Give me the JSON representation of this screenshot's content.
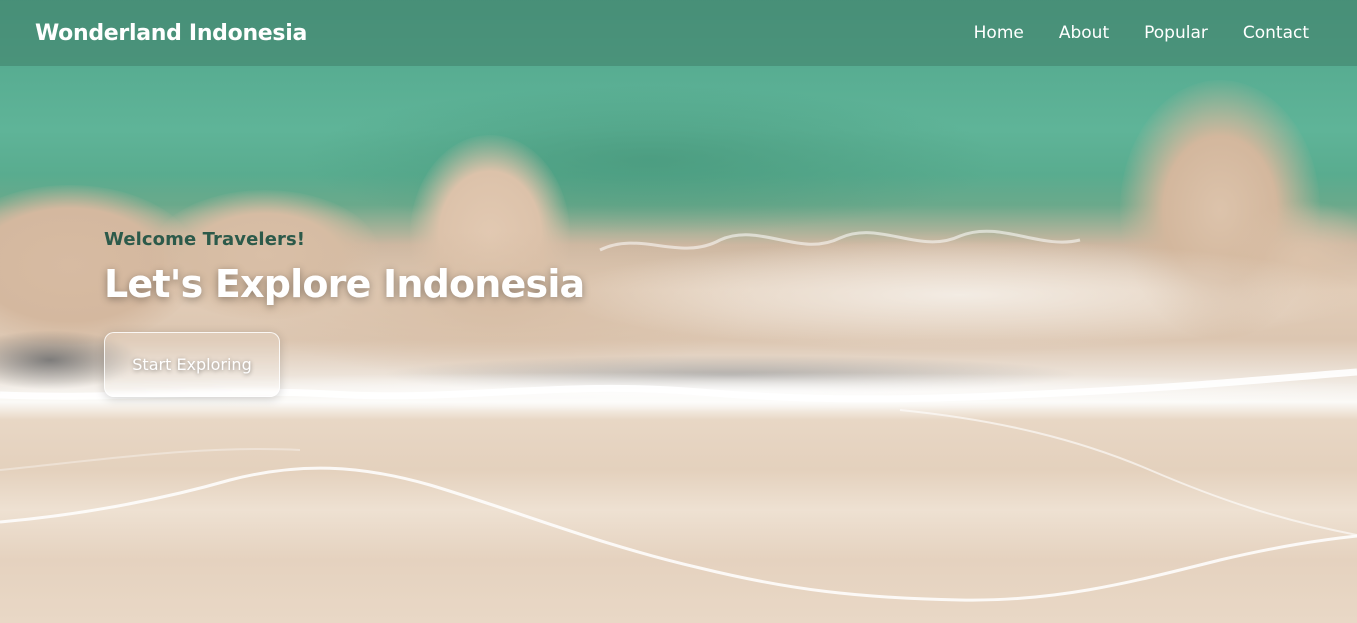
{
  "navbar": {
    "brand": "Wonderland Indonesia",
    "links": [
      {
        "label": "Home"
      },
      {
        "label": "About"
      },
      {
        "label": "Popular"
      },
      {
        "label": "Contact"
      }
    ]
  },
  "hero": {
    "greeting": "Welcome Travelers!",
    "headline": "Let's Explore Indonesia",
    "cta_label": "Start Exploring"
  },
  "colors": {
    "navbar_bg": "#499077",
    "greeting_text": "#2c5a4a",
    "text_light": "#ffffff",
    "sea": "#5fb498",
    "sand": "#e5d2bf"
  }
}
